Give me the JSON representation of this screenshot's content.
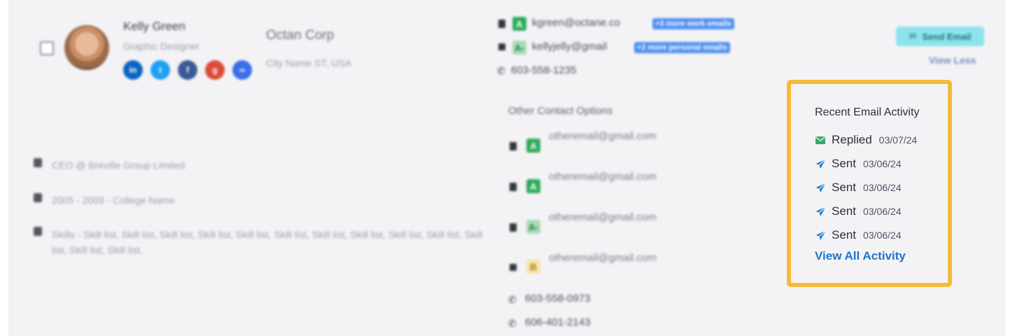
{
  "contact": {
    "name": "Kelly Green",
    "title": "Graphic Designer",
    "company": "Octan Corp",
    "location": "City Name ST, USA",
    "socials": [
      {
        "icon": "linkedin-icon",
        "glyph": "in",
        "color": "#0a66c2"
      },
      {
        "icon": "twitter-icon",
        "glyph": "t",
        "color": "#1da1f2"
      },
      {
        "icon": "facebook-icon",
        "glyph": "f",
        "color": "#3b5998"
      },
      {
        "icon": "google-plus-icon",
        "glyph": "g",
        "color": "#dd4b39"
      },
      {
        "icon": "link-icon",
        "glyph": "∞",
        "color": "#3b6de8"
      }
    ]
  },
  "details": [
    "CEO @ Breville Group Limited",
    "2005 - 2009 - College Name",
    "Skills - Skill list, Skill list, Skill list, Skill list, Skill list, Skill list, Skill list, Skill list, Skill list, Skill list, Skill list, Skill list, Skill list."
  ],
  "emails": {
    "work": {
      "grade": "A",
      "address": "kgreen@octane.co",
      "more": "+3 more work emails"
    },
    "personal": {
      "grade": "A-",
      "address": "kellyjelly@gmail",
      "more": "+2 more personal emails"
    },
    "phone": "603-558-1235"
  },
  "other_contact": {
    "heading": "Other Contact Options",
    "emails": [
      {
        "grade": "A",
        "address": "otheremail@gmail.com",
        "type": "bookmark"
      },
      {
        "grade": "A",
        "address": "otheremail@gmail.com",
        "type": "bookmark"
      },
      {
        "grade": "A-",
        "address": "otheremail@gmail.com",
        "type": "bookmark"
      },
      {
        "grade": "B",
        "address": "otheremail@gmail.com",
        "type": "envelope"
      }
    ],
    "phones": [
      "603-558-0973",
      "606-401-2143"
    ]
  },
  "actions": {
    "send_email": "Send Email",
    "view_less": "View Less"
  },
  "activity": {
    "heading": "Recent Email Activity",
    "items": [
      {
        "label": "Replied",
        "date": "03/07/24",
        "icon": "envelope-icon"
      },
      {
        "label": "Sent",
        "date": "03/06/24",
        "icon": "paper-plane-icon"
      },
      {
        "label": "Sent",
        "date": "03/06/24",
        "icon": "paper-plane-icon"
      },
      {
        "label": "Sent",
        "date": "03/06/24",
        "icon": "paper-plane-icon"
      },
      {
        "label": "Sent",
        "date": "03/06/24",
        "icon": "paper-plane-icon"
      }
    ],
    "view_all": "View All Activity",
    "colors": {
      "highlight": "#f6b93b",
      "link": "#1f74c9",
      "replied": "#3aa76d",
      "sent": "#1f74c9"
    }
  }
}
